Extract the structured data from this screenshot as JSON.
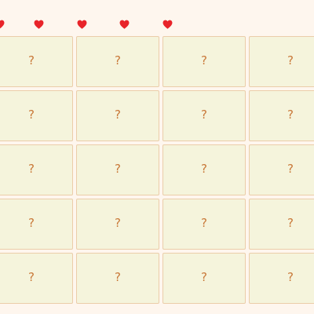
{
  "lives": {
    "count": 5,
    "icon": "heart-icon",
    "color": "#e8242a"
  },
  "board": {
    "card_face": "?",
    "colors": {
      "background": "#fef6ee",
      "card_fill": "#f5f4dc",
      "card_border": "#ebcda9",
      "card_mark": "#c9793a"
    },
    "rows": [
      [
        "?",
        "?",
        "?",
        "?"
      ],
      [
        "?",
        "?",
        "?",
        "?"
      ],
      [
        "?",
        "?",
        "?",
        "?"
      ],
      [
        "?",
        "?",
        "?",
        "?"
      ],
      [
        "?",
        "?",
        "?",
        "?"
      ]
    ]
  }
}
